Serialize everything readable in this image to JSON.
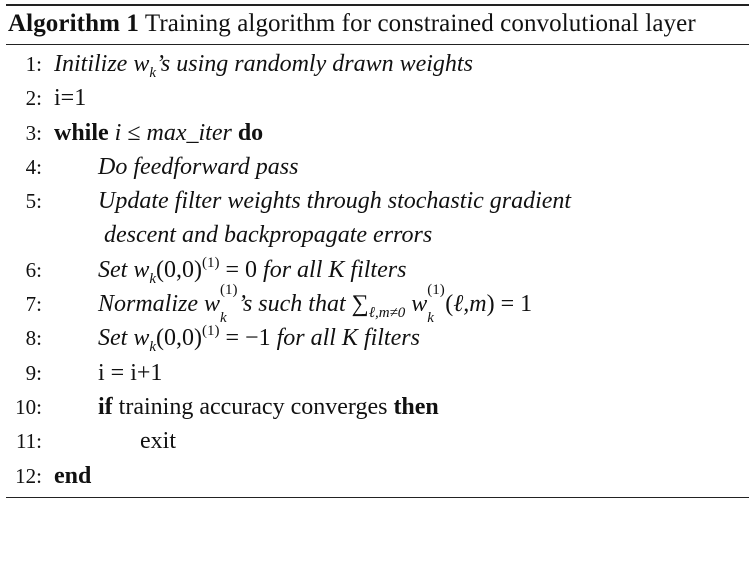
{
  "caption": {
    "label": "Algorithm 1",
    "text": "Training algorithm for constrained convolutional layer"
  },
  "lines": [
    {
      "n": "1:",
      "text": "Initilize w_k's using randomly drawn weights"
    },
    {
      "n": "2:",
      "text": "i=1"
    },
    {
      "n": "3:",
      "kw1": "while",
      "cond": "i ≤ max_iter",
      "kw2": "do"
    },
    {
      "n": "4:",
      "text": "Do feedforward pass"
    },
    {
      "n": "5:",
      "text": "Update filter weights through stochastic gradient",
      "cont": "descent and backpropagate errors"
    },
    {
      "n": "6:",
      "pre": "Set",
      "post": "for all K filters"
    },
    {
      "n": "7:",
      "pre": "Normalize",
      "mid": "s such that",
      "post": "= 1"
    },
    {
      "n": "8:",
      "pre": "Set",
      "post": "for all K filters"
    },
    {
      "n": "9:",
      "text": "i = i+1"
    },
    {
      "n": "10:",
      "kw1": "if",
      "text": "training accuracy converges",
      "kw2": "then"
    },
    {
      "n": "11:",
      "text": "exit"
    },
    {
      "n": "12:",
      "kw1": "end"
    }
  ]
}
